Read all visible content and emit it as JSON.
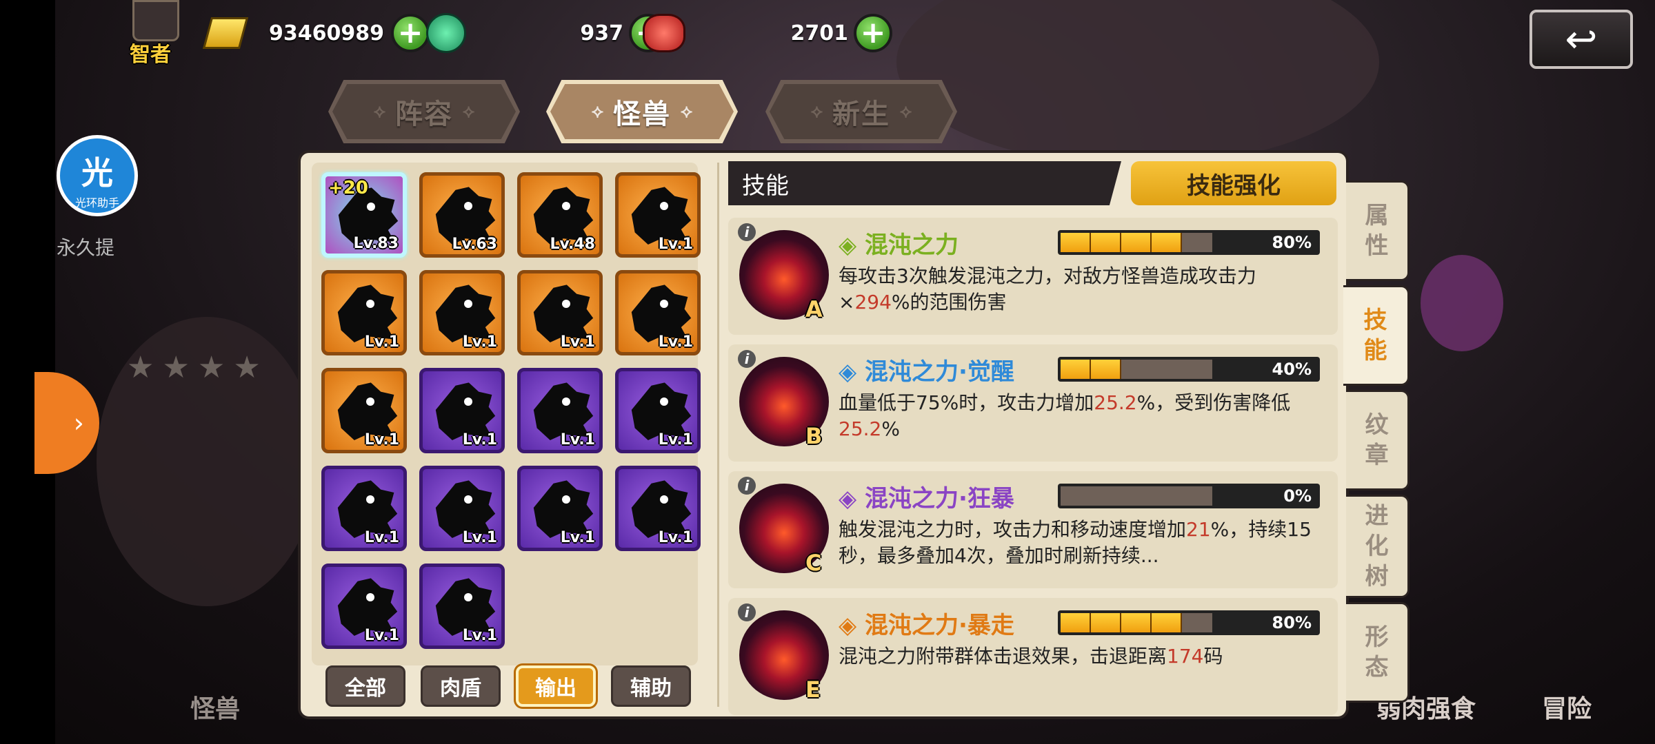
{
  "top_bar": {
    "title_badge": "智者",
    "gold": "93460989",
    "green_gem": "937",
    "red_gem": "2701",
    "plus_label": "+",
    "back_icon": "back-arrow-icon"
  },
  "tabs": [
    {
      "label": "阵容",
      "active": false
    },
    {
      "label": "怪兽",
      "active": true
    },
    {
      "label": "新生",
      "active": false
    }
  ],
  "tab_deco": "⟡",
  "left_sidebar": {
    "helper_big": "光",
    "helper_small": "光环助手",
    "permanent_text": "永久提",
    "arrow": "›"
  },
  "monsters": [
    {
      "level": "Lv.83",
      "rarity": "special",
      "tag": "+20"
    },
    {
      "level": "Lv.63",
      "rarity": "orange"
    },
    {
      "level": "Lv.48",
      "rarity": "orange"
    },
    {
      "level": "Lv.1",
      "rarity": "orange"
    },
    {
      "level": "Lv.1",
      "rarity": "orange"
    },
    {
      "level": "Lv.1",
      "rarity": "orange"
    },
    {
      "level": "Lv.1",
      "rarity": "orange"
    },
    {
      "level": "Lv.1",
      "rarity": "orange"
    },
    {
      "level": "Lv.1",
      "rarity": "orange"
    },
    {
      "level": "Lv.1",
      "rarity": "purple"
    },
    {
      "level": "Lv.1",
      "rarity": "purple"
    },
    {
      "level": "Lv.1",
      "rarity": "purple"
    },
    {
      "level": "Lv.1",
      "rarity": "purple"
    },
    {
      "level": "Lv.1",
      "rarity": "purple"
    },
    {
      "level": "Lv.1",
      "rarity": "purple"
    },
    {
      "level": "Lv.1",
      "rarity": "purple"
    },
    {
      "level": "Lv.1",
      "rarity": "purple"
    },
    {
      "level": "Lv.1",
      "rarity": "purple"
    }
  ],
  "filters": [
    {
      "label": "全部",
      "active": false
    },
    {
      "label": "肉盾",
      "active": false
    },
    {
      "label": "输出",
      "active": true
    },
    {
      "label": "辅助",
      "active": false
    }
  ],
  "skills_header": "技能",
  "skill_enhance_button": "技能强化",
  "skills": [
    {
      "name": "混沌之力",
      "name_color": "#7bb020",
      "grade": "A",
      "progress_pct": "80%",
      "progress": 0.8,
      "desc_parts": [
        "每攻击3次触发混沌之力，对敌方怪兽造成攻击力×",
        "294",
        "%的范围伤害"
      ]
    },
    {
      "name": "混沌之力·觉醒",
      "name_color": "#2f8ad8",
      "grade": "B",
      "progress_pct": "40%",
      "progress": 0.4,
      "desc_parts": [
        "血量低于75%时，攻击力增加",
        "25.2",
        "%，受到伤害降低",
        "25.2",
        "%"
      ]
    },
    {
      "name": "混沌之力·狂暴",
      "name_color": "#8a44c4",
      "grade": "C",
      "progress_pct": "0%",
      "progress": 0,
      "desc_parts": [
        "触发混沌之力时，攻击力和移动速度增加",
        "21",
        "%，持续15秒，最多叠加4次，叠加时刷新持续..."
      ]
    },
    {
      "name": "混沌之力·暴走",
      "name_color": "#e07a14",
      "grade": "E",
      "progress_pct": "80%",
      "progress": 0.8,
      "desc_parts": [
        "混沌之力附带群体击退效果，击退距离",
        "174",
        "码"
      ]
    }
  ],
  "info_glyph": "i",
  "side_tabs": [
    {
      "label": "属性",
      "active": false
    },
    {
      "label": "技能",
      "active": true
    },
    {
      "label": "纹章",
      "active": false
    },
    {
      "label": "进化树",
      "active": false
    },
    {
      "label": "形态",
      "active": false
    }
  ],
  "bottom_nav": {
    "monster": "怪兽",
    "eat": "弱肉强食",
    "adventure": "冒险"
  },
  "colors": {
    "highlight": "#c43a2a",
    "accent": "#e08a18",
    "panel": "#efe6d0"
  }
}
